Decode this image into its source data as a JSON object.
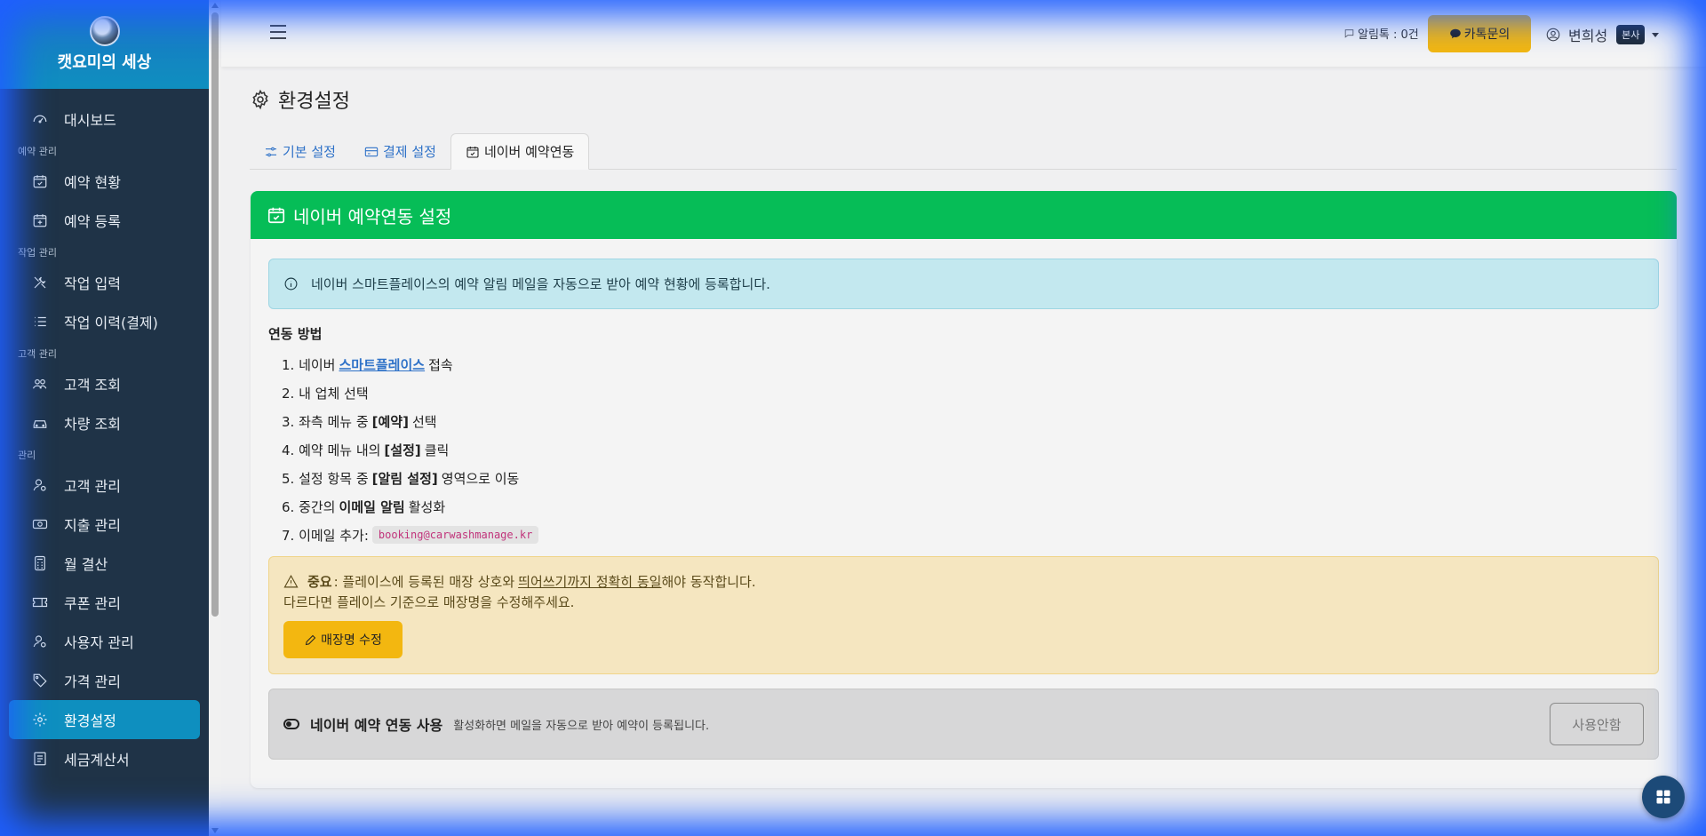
{
  "brand": {
    "title": "캣요미의 세상"
  },
  "sidebar": {
    "items": [
      {
        "label": "대시보드",
        "icon": "dashboard-icon"
      },
      {
        "section": "예약 관리"
      },
      {
        "label": "예약 현황",
        "icon": "calendar-check-icon"
      },
      {
        "label": "예약 등록",
        "icon": "calendar-plus-icon"
      },
      {
        "section": "작업 관리"
      },
      {
        "label": "작업 입력",
        "icon": "tools-icon"
      },
      {
        "label": "작업 이력(결제)",
        "icon": "list-icon"
      },
      {
        "section": "고객 관리"
      },
      {
        "label": "고객 조회",
        "icon": "people-icon"
      },
      {
        "label": "차량 조회",
        "icon": "car-icon"
      },
      {
        "section": "관리"
      },
      {
        "label": "고객 관리",
        "icon": "user-gear-icon"
      },
      {
        "label": "지출 관리",
        "icon": "cash-icon"
      },
      {
        "label": "월 결산",
        "icon": "calculator-icon"
      },
      {
        "label": "쿠폰 관리",
        "icon": "ticket-icon"
      },
      {
        "label": "사용자 관리",
        "icon": "user-gear-icon"
      },
      {
        "label": "가격 관리",
        "icon": "tag-icon"
      },
      {
        "label": "환경설정",
        "icon": "gear-icon",
        "active": true
      },
      {
        "label": "세금계산서",
        "icon": "receipt-icon"
      }
    ]
  },
  "topbar": {
    "kakao_notice": "알림톡 : 0건",
    "kakao_button": "카톡문의",
    "user_name": "변희성",
    "branch": "본사"
  },
  "page": {
    "title": "환경설정"
  },
  "tabs": [
    {
      "label": "기본 설정",
      "icon": "sliders-icon"
    },
    {
      "label": "결제 설정",
      "icon": "credit-card-icon"
    },
    {
      "label": "네이버 예약연동",
      "icon": "calendar-check-icon",
      "active": true
    }
  ],
  "card": {
    "header": "네이버 예약연동 설정",
    "info": "네이버 스마트플레이스의 예약 알림 메일을 자동으로 받아 예약 현황에 등록합니다.",
    "method_title": "연동 방법",
    "steps": {
      "s1_pre": "1. 네이버",
      "s1_link": "스마트플레이스",
      "s1_post": "접속",
      "s2": "2. 내 업체 선택",
      "s3_pre": "3. 좌측 메뉴 중",
      "s3_bold": "[예약]",
      "s3_post": "선택",
      "s4_pre": "4. 예약 메뉴 내의",
      "s4_bold": "[설정]",
      "s4_post": "클릭",
      "s5_pre": "5. 설정 항목 중",
      "s5_bold": "[알림 설정]",
      "s5_post": "영역으로 이동",
      "s6_pre": "6. 중간의",
      "s6_bold": "이메일 알림",
      "s6_post": "활성화",
      "s7_pre": "7. 이메일 추가:",
      "s7_code": "booking@carwashmanage.kr"
    },
    "warning": {
      "bold": "중요",
      "text1": ": 플레이스에 등록된 매장 상호와",
      "underline": "띄어쓰기까지 정확히 동일",
      "text2": "해야 동작합니다.",
      "line2": "다르다면 플레이스 기준으로 매장명을 수정해주세요.",
      "button": "매장명 수정"
    },
    "toggle": {
      "title": "네이버 예약 연동 사용",
      "desc": "활성화하면 메일을 자동으로 받아 예약이 등록됩니다.",
      "button": "사용안함"
    }
  },
  "colors": {
    "sidebar": "#1f3347",
    "brand": "#1b74c6",
    "active": "#0e8fbf",
    "card_header": "#06bd57",
    "kakao": "#f3b710"
  }
}
